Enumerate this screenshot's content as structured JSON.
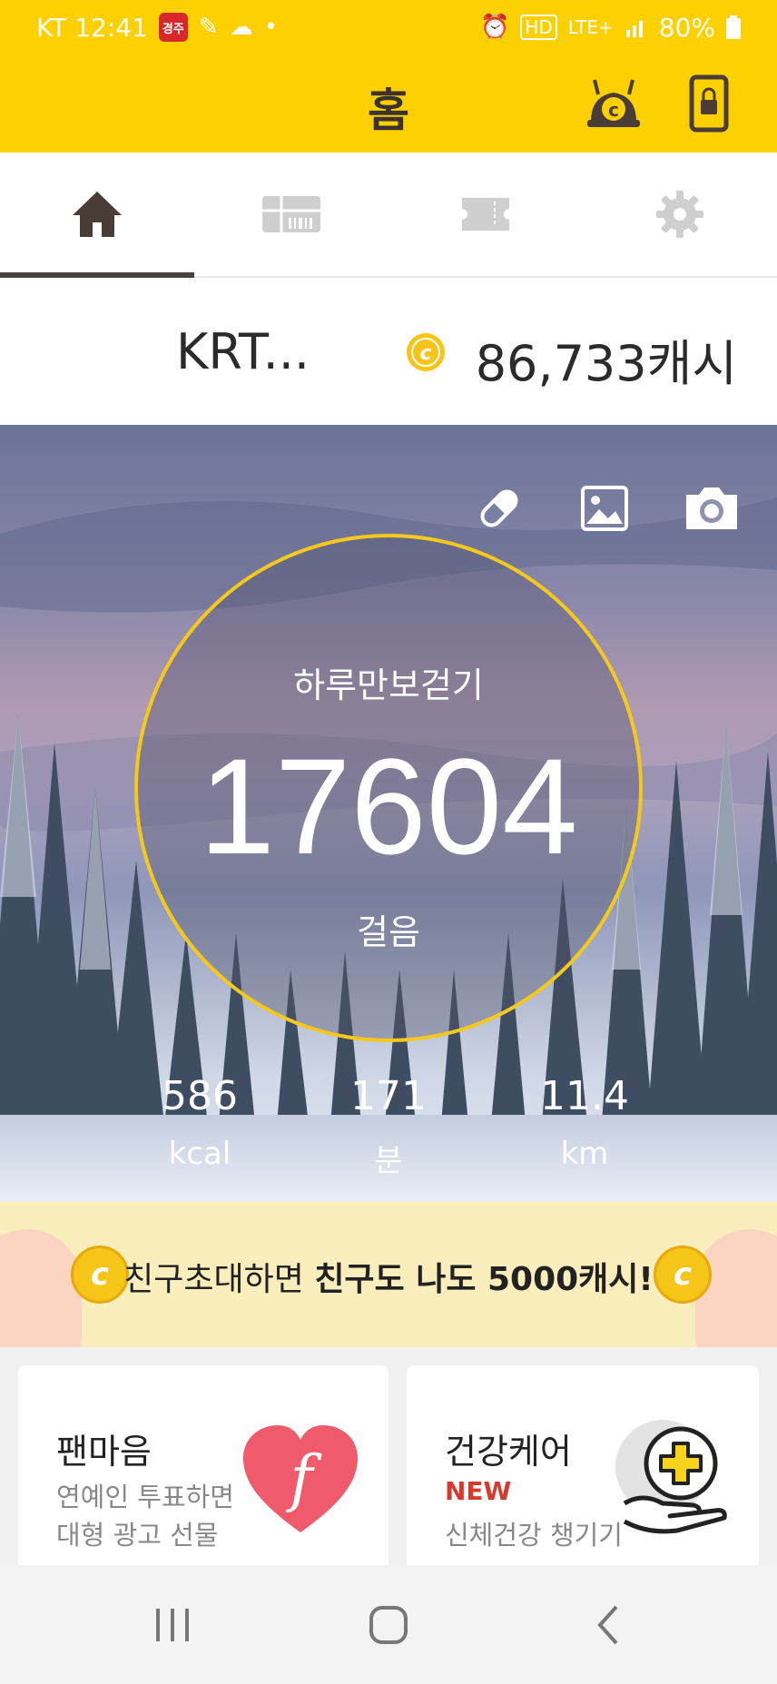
{
  "status_bar": {
    "carrier_time": "KT 12:41",
    "badge_text": "경주",
    "network": "LTE+",
    "battery": "80%"
  },
  "header": {
    "title": "홈"
  },
  "tabs": [
    {
      "icon": "home-icon",
      "active": true
    },
    {
      "icon": "gift-card-icon",
      "active": false
    },
    {
      "icon": "ticket-icon",
      "active": false
    },
    {
      "icon": "gear-icon",
      "active": false
    }
  ],
  "account": {
    "name": "KRT...",
    "cash": "86,733캐시",
    "coin_symbol": "c"
  },
  "hero": {
    "label": "하루만보걷기",
    "steps": "17604",
    "unit": "걸음",
    "stats": [
      {
        "value": "586",
        "unit": "kcal"
      },
      {
        "value": "171",
        "unit": "분"
      },
      {
        "value": "11.4",
        "unit": "km"
      }
    ]
  },
  "promo": {
    "text_plain": "친구초대하면 ",
    "text_bold": "친구도 나도 5000캐시!",
    "coin_symbol": "c"
  },
  "cards": {
    "left": {
      "title": "팬마음",
      "line1": "연예인 투표하면",
      "line2": "대형 광고 선물",
      "logo": "f"
    },
    "right": {
      "title": "건강케어",
      "badge": "NEW",
      "line1": "신체건강 챙기기"
    }
  },
  "colors": {
    "brand_yellow": "#fdd000",
    "ring": "#f5c91c",
    "new_red": "#d63a2e"
  }
}
